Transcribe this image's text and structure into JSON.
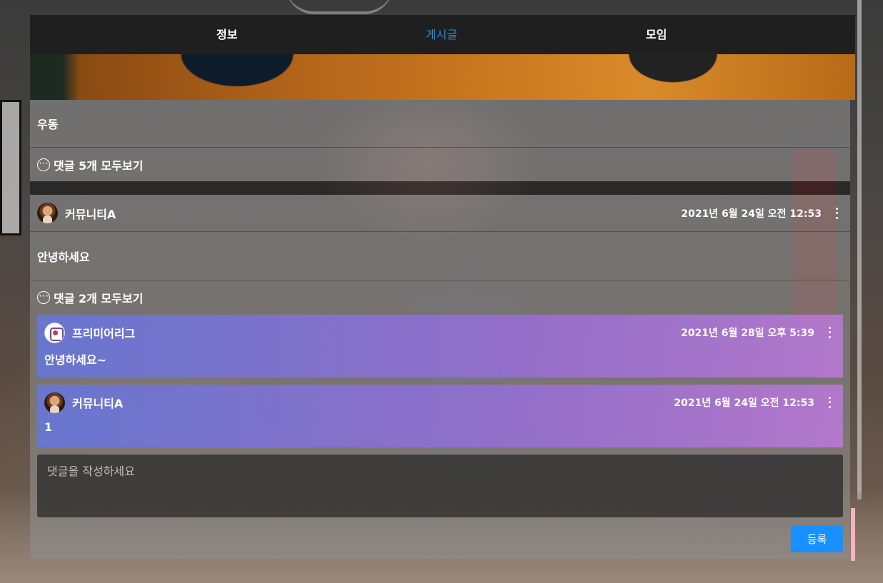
{
  "tabs": [
    {
      "label": "정보",
      "active": false
    },
    {
      "label": "게시글",
      "active": true
    },
    {
      "label": "모임",
      "active": false
    }
  ],
  "colors": {
    "accent": "#1890ff",
    "active_tab": "#1a8fe6",
    "nav_bg": "#1f1f1f"
  },
  "prev_post": {
    "content": "우동",
    "comments_link": "댓글 5개 모두보기"
  },
  "post": {
    "author": "커뮤니티A",
    "date": "2021년 6월 24일 오전 12:53",
    "content": "안녕하세요",
    "comments_link": "댓글 2개 모두보기",
    "comments": [
      {
        "author": "프리미어리그",
        "date": "2021년 6월 28일 오후 5:39",
        "text": "안녕하세요~",
        "avatar": "league-logo-icon"
      },
      {
        "author": "커뮤니티A",
        "date": "2021년 6월 24일 오전 12:53",
        "text": "1",
        "avatar": "person-avatar-icon"
      }
    ]
  },
  "comment_form": {
    "placeholder": "댓글을 작성하세요",
    "submit_label": "등록"
  }
}
